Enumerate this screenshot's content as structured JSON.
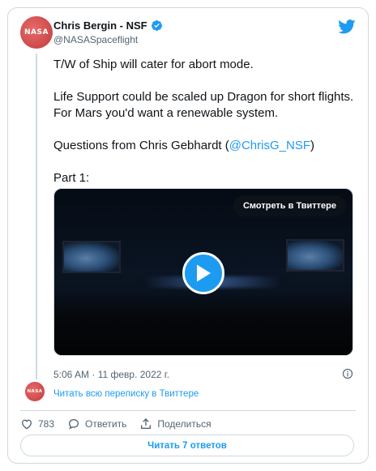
{
  "author": {
    "name": "Chris Bergin - NSF",
    "handle": "@NASASpaceflight",
    "avatar_text": "NASA"
  },
  "tweet": {
    "p1": "T/W of Ship will cater for abort mode.",
    "p2": "Life Support could be scaled up Dragon for short flights. For Mars you'd want a renewable system.",
    "p3_prefix": "Questions from Chris Gebhardt (",
    "p3_mention": "@ChrisG_NSF",
    "p3_suffix": ")",
    "p4": "Part 1:"
  },
  "media": {
    "watch_label": "Смотреть в Твиттере"
  },
  "timestamp": "5:06 AM · 11 февр. 2022 г.",
  "thread_link": "Читать всю переписку в Твиттере",
  "actions": {
    "like_count": "783",
    "reply_label": "Ответить",
    "share_label": "Поделиться"
  },
  "read_replies_label": "Читать 7 ответов",
  "colors": {
    "accent": "#1d9bf0",
    "secondary_text": "#536471",
    "border": "#cfd9de"
  }
}
